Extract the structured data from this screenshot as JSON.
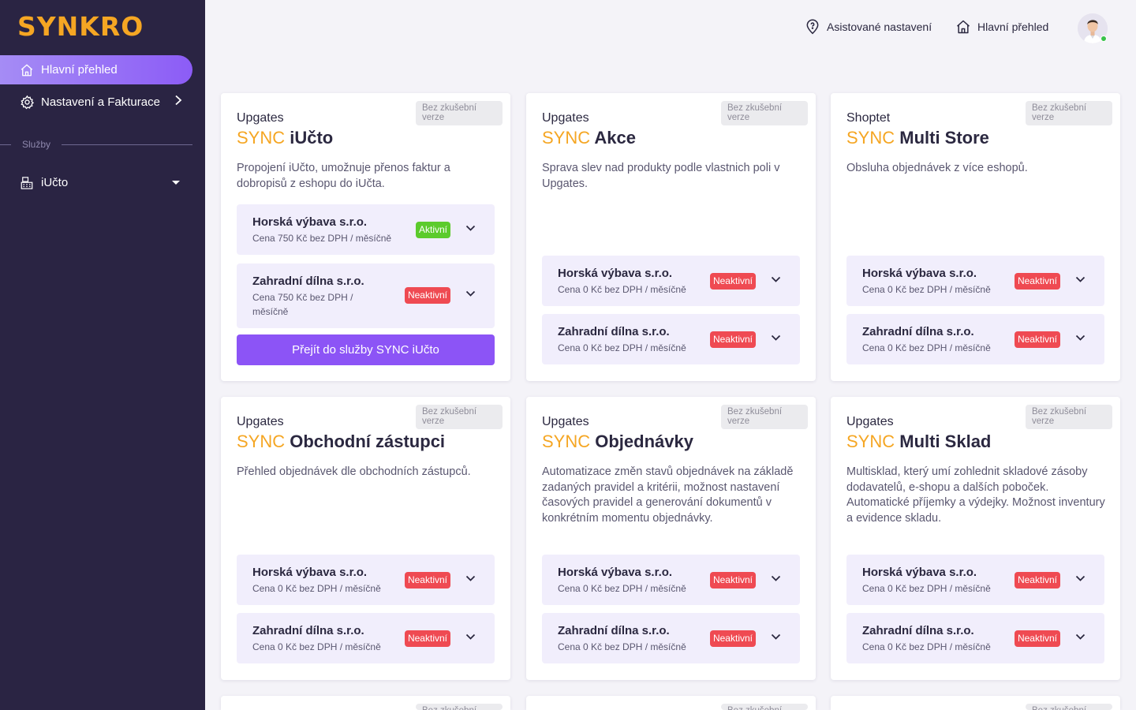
{
  "app": {
    "logo": "SYNKRO"
  },
  "sidebar": {
    "items": [
      {
        "label": "Hlavní přehled",
        "icon": "home-icon"
      },
      {
        "label": "Nastavení a Fakturace",
        "icon": "gear-icon"
      }
    ],
    "section_label": "Služby",
    "services": [
      {
        "label": "iUčto",
        "icon": "calculator-icon"
      }
    ]
  },
  "header": {
    "assist_label": "Asistované nastavení",
    "home_label": "Hlavní přehled"
  },
  "colors": {
    "accent": "#8c54f6",
    "brand": "#f5a623",
    "active_badge": "#5ccb2c",
    "inactive_badge": "#ef4a52",
    "sidebar_bg": "#2a2443"
  },
  "cards": [
    {
      "trial": "Bez zkušební verze",
      "vendor": "Upgates",
      "sync": "SYNC",
      "name": "iUčto",
      "description": "Propojení iUčto, umožnuje přenos faktur a dobropisů z eshopu do iUčta.",
      "clients": [
        {
          "name": "Horská výbava s.r.o.",
          "price": "Cena 750 Kč bez DPH / měsíčně",
          "status": "Aktivní"
        },
        {
          "name": "Zahradní dílna s.r.o.",
          "price": "Cena 750 Kč bez DPH / měsíčně",
          "status": "Neaktivní"
        }
      ],
      "button": "Přejít do služby SYNC iUčto"
    },
    {
      "trial": "Bez zkušební verze",
      "vendor": "Upgates",
      "sync": "SYNC",
      "name": "Akce",
      "description": "Sprava slev nad produkty podle vlastnich poli v Upgates.",
      "clients": [
        {
          "name": "Horská výbava s.r.o.",
          "price": "Cena 0 Kč bez DPH / měsíčně",
          "status": "Neaktivní"
        },
        {
          "name": "Zahradní dílna s.r.o.",
          "price": "Cena 0 Kč bez DPH / měsíčně",
          "status": "Neaktivní"
        }
      ]
    },
    {
      "trial": "Bez zkušební verze",
      "vendor": "Shoptet",
      "sync": "SYNC",
      "name": "Multi Store",
      "description": "Obsluha objednávek z více eshopů.",
      "clients": [
        {
          "name": "Horská výbava s.r.o.",
          "price": "Cena 0 Kč bez DPH / měsíčně",
          "status": "Neaktivní"
        },
        {
          "name": "Zahradní dílna s.r.o.",
          "price": "Cena 0 Kč bez DPH / měsíčně",
          "status": "Neaktivní"
        }
      ]
    },
    {
      "trial": "Bez zkušební verze",
      "vendor": "Upgates",
      "sync": "SYNC",
      "name": "Obchodní zástupci",
      "description": "Přehled objednávek dle obchodních zástupců.",
      "clients": [
        {
          "name": "Horská výbava s.r.o.",
          "price": "Cena 0 Kč bez DPH / měsíčně",
          "status": "Neaktivní"
        },
        {
          "name": "Zahradní dílna s.r.o.",
          "price": "Cena 0 Kč bez DPH / měsíčně",
          "status": "Neaktivní"
        }
      ]
    },
    {
      "trial": "Bez zkušební verze",
      "vendor": "Upgates",
      "sync": "SYNC",
      "name": "Objednávky",
      "description": "Automatizace změn stavů objednávek na základě zadaných pravidel a kritérii, možnost nastavení časových pravidel a generování dokumentů v konkrétním momentu objednávky.",
      "clients": [
        {
          "name": "Horská výbava s.r.o.",
          "price": "Cena 0 Kč bez DPH / měsíčně",
          "status": "Neaktivní"
        },
        {
          "name": "Zahradní dílna s.r.o.",
          "price": "Cena 0 Kč bez DPH / měsíčně",
          "status": "Neaktivní"
        }
      ]
    },
    {
      "trial": "Bez zkušební verze",
      "vendor": "Upgates",
      "sync": "SYNC",
      "name": "Multi Sklad",
      "description": "Multisklad, který umí zohlednit skladové zásoby dodavatelů, e-shopu a dalších poboček. Automatické příjemky a výdejky. Možnost inventury a evidence skladu.",
      "clients": [
        {
          "name": "Horská výbava s.r.o.",
          "price": "Cena 0 Kč bez DPH / měsíčně",
          "status": "Neaktivní"
        },
        {
          "name": "Zahradní dílna s.r.o.",
          "price": "Cena 0 Kč bez DPH / měsíčně",
          "status": "Neaktivní"
        }
      ]
    },
    {
      "trial": "Bez zkušební verze"
    },
    {
      "trial": "Bez zkušební verze"
    },
    {
      "trial": "Bez zkušební verze"
    }
  ]
}
